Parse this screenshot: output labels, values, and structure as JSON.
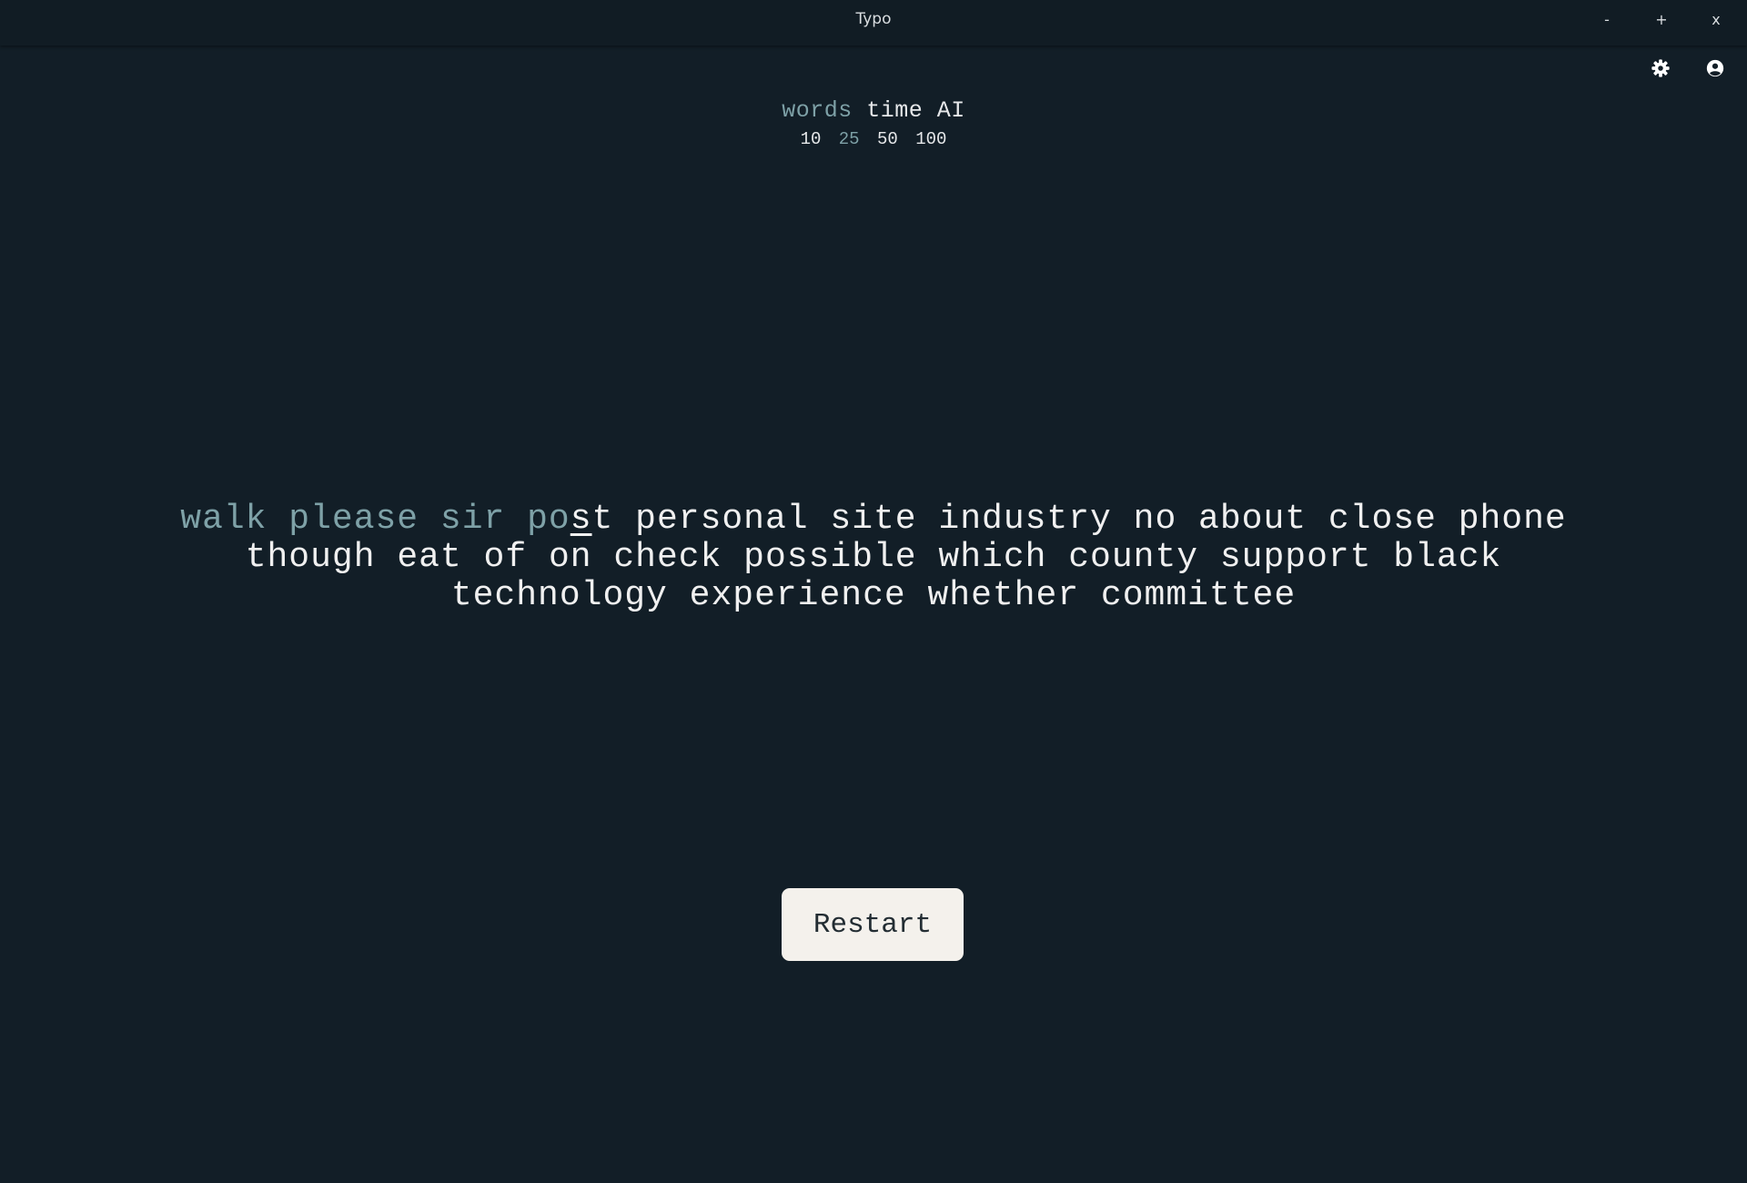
{
  "window": {
    "title": "Typo",
    "minimize_label": "-",
    "maximize_label": "+",
    "close_label": "x"
  },
  "toolbar": {
    "settings_icon": "gear-icon",
    "account_icon": "user-circle-icon"
  },
  "modes": {
    "items": [
      {
        "label": "words",
        "active": true
      },
      {
        "label": "time",
        "active": false
      },
      {
        "label": "AI",
        "active": false
      }
    ]
  },
  "counts": {
    "items": [
      {
        "label": "10",
        "active": false
      },
      {
        "label": "25",
        "active": true
      },
      {
        "label": "50",
        "active": false
      },
      {
        "label": "100",
        "active": false
      }
    ]
  },
  "typing": {
    "typed_text": "walk please sir po",
    "cursor_char": "s",
    "remaining_text": "t personal site industry no about close phone though eat of on check possible which county support black technology experience whether committee"
  },
  "restart_label": "Restart",
  "colors": {
    "background": "#121e27",
    "accent": "#7ea1a7",
    "text": "#f0f0f0",
    "button_bg": "#f4f1ec"
  }
}
